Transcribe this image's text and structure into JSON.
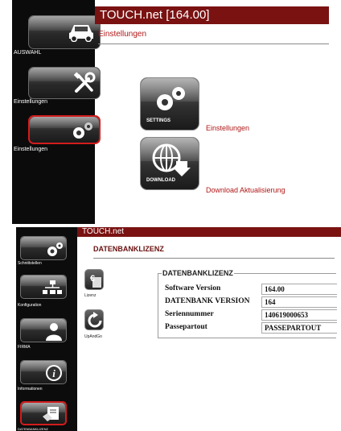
{
  "top": {
    "title": "TOUCH.net [164.00]",
    "breadcrumb": "Einstellungen",
    "sidebar": [
      {
        "label": "AUSWAHL",
        "icon": "car-icon"
      },
      {
        "label": "Einstellungen",
        "icon": "tools-icon"
      },
      {
        "label": "Einstellungen",
        "icon": "gears-icon",
        "active": true
      }
    ],
    "actions": [
      {
        "tile_text": "SETTINGS",
        "link": "Einstellungen",
        "icon": "gears-icon"
      },
      {
        "tile_text": "DOWNLOAD",
        "link": "Download Aktualisierung",
        "icon": "globe-download-icon"
      }
    ]
  },
  "bottom": {
    "title": "TOUCH.net",
    "heading": "DATENBANKLIZENZ",
    "sidebar": [
      {
        "label": "Schnittstellen",
        "icon": "gears-icon"
      },
      {
        "label": "Konfiguration",
        "icon": "network-icon"
      },
      {
        "label": "FIRMA",
        "icon": "person-icon"
      },
      {
        "label": "Informationen",
        "icon": "info-icon"
      },
      {
        "label": "DATENBANKLIZENZ",
        "icon": "license-icon",
        "active": true
      }
    ],
    "mini_icons": [
      {
        "label": "Lizenz",
        "icon": "euro-document-icon"
      },
      {
        "label": "UpAndGo",
        "icon": "refresh-icon"
      }
    ],
    "license": {
      "legend": "DATENBANKLIZENZ",
      "rows": [
        {
          "key": "Software Version",
          "value": "164.00"
        },
        {
          "key": "DATENBANK VERSION",
          "value": "164"
        },
        {
          "key": "Seriennummer",
          "value": "140619000653"
        },
        {
          "key": "Passepartout",
          "value": "PASSEPARTOUT"
        }
      ]
    }
  },
  "colors": {
    "titlebar": "#7a1212",
    "link": "#b01818",
    "active_border": "#d21c1c"
  }
}
